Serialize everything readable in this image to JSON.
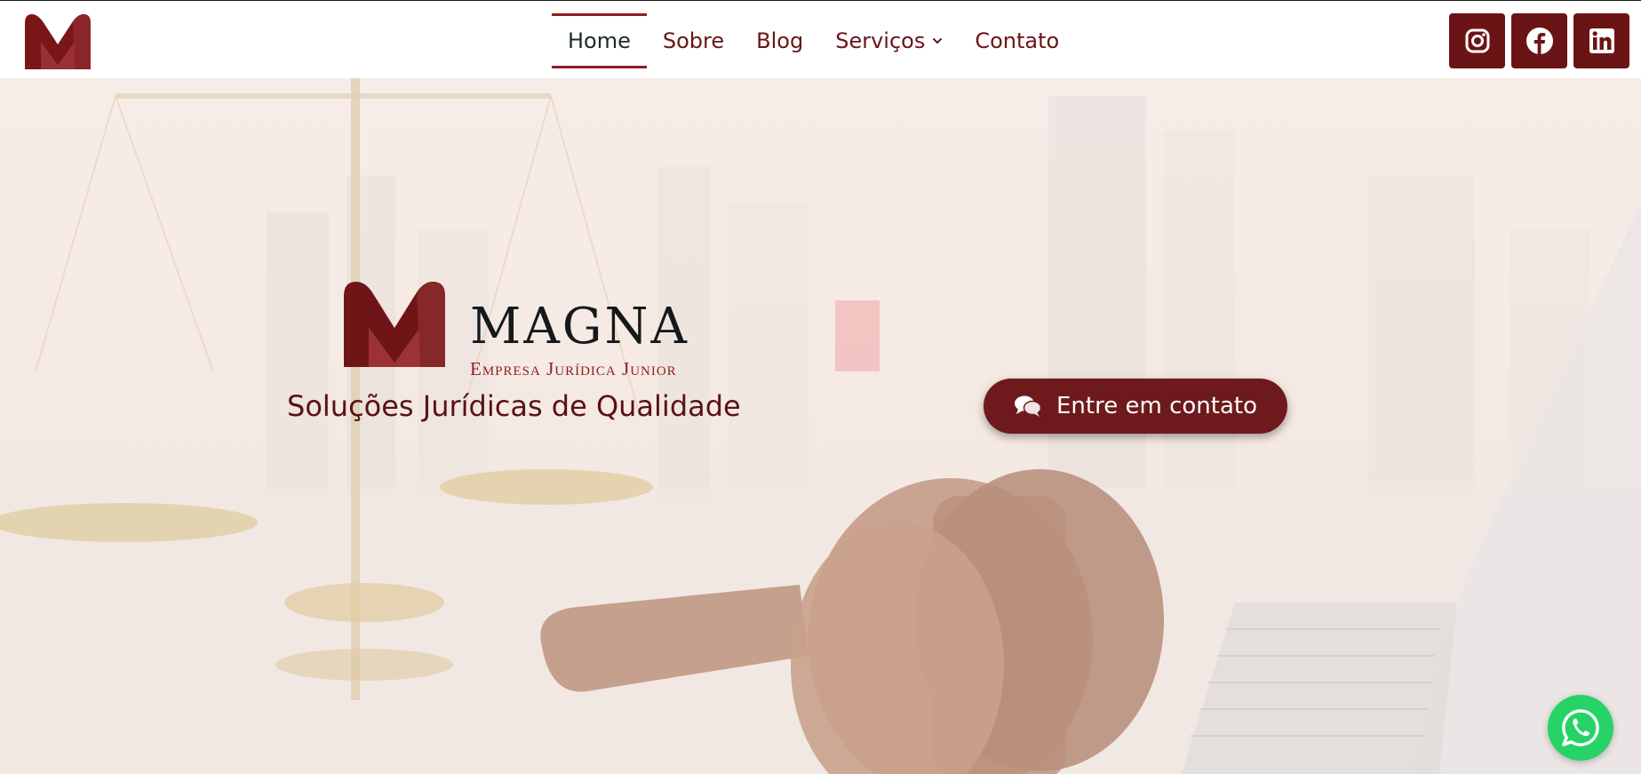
{
  "nav": {
    "items": [
      {
        "label": "Home",
        "active": true
      },
      {
        "label": "Sobre"
      },
      {
        "label": "Blog"
      },
      {
        "label": "Serviços",
        "has_dropdown": true
      },
      {
        "label": "Contato"
      }
    ]
  },
  "social": {
    "links": [
      "instagram-icon",
      "facebook-icon",
      "linkedin-icon"
    ]
  },
  "brand": {
    "name": "MAGNA",
    "subtitle": "Empresa Jurídica Junior",
    "color": "#6b1416"
  },
  "hero": {
    "tagline": "Soluções Jurídicas de Qualidade",
    "cta_label": "Entre em contato",
    "cta_icon": "chat-bubbles-icon"
  },
  "floating": {
    "whatsapp_icon": "whatsapp-icon",
    "color": "#25d366"
  }
}
